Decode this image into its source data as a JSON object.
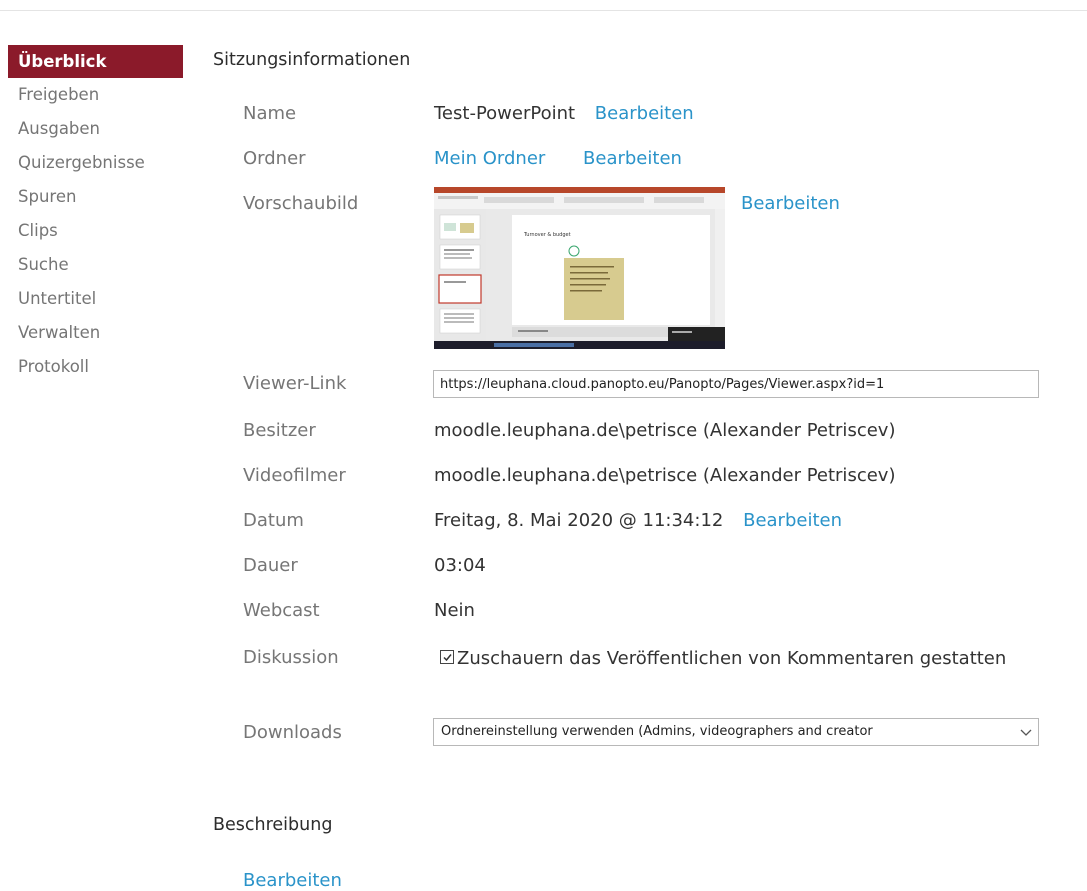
{
  "sidebar": {
    "items": [
      {
        "label": "Überblick"
      },
      {
        "label": "Freigeben"
      },
      {
        "label": "Ausgaben"
      },
      {
        "label": "Quizergebnisse"
      },
      {
        "label": "Spuren"
      },
      {
        "label": "Clips"
      },
      {
        "label": "Suche"
      },
      {
        "label": "Untertitel"
      },
      {
        "label": "Verwalten"
      },
      {
        "label": "Protokoll"
      }
    ]
  },
  "session": {
    "title": "Sitzungsinformationen",
    "name": {
      "label": "Name",
      "value": "Test-PowerPoint",
      "edit": "Bearbeiten"
    },
    "folder": {
      "label": "Ordner",
      "value": "Mein Ordner",
      "edit": "Bearbeiten"
    },
    "thumbnail": {
      "label": "Vorschaubild",
      "edit": "Bearbeiten",
      "slide_title": "Turnover & budget"
    },
    "viewer_link": {
      "label": "Viewer-Link",
      "value": "https://leuphana.cloud.panopto.eu/Panopto/Pages/Viewer.aspx?id=1"
    },
    "owner": {
      "label": "Besitzer",
      "value": "moodle.leuphana.de\\petrisce (Alexander Petriscev)"
    },
    "videographer": {
      "label": "Videofilmer",
      "value": "moodle.leuphana.de\\petrisce (Alexander Petriscev)"
    },
    "date": {
      "label": "Datum",
      "value": "Freitag, 8. Mai 2020 @ 11:34:12",
      "edit": "Bearbeiten"
    },
    "duration": {
      "label": "Dauer",
      "value": "03:04"
    },
    "webcast": {
      "label": "Webcast",
      "value": "Nein"
    },
    "discussion": {
      "label": "Diskussion",
      "checkbox_label": "Zuschauern das Veröffentlichen von Kommentaren gestatten",
      "checked": true
    },
    "downloads": {
      "label": "Downloads",
      "selected": "Ordnereinstellung verwenden (Admins, videographers and creator"
    }
  },
  "description": {
    "title": "Beschreibung",
    "edit": "Bearbeiten"
  },
  "colors": {
    "accent_active": "#8b1a2a",
    "link": "#2a93c9",
    "label": "#767676"
  }
}
